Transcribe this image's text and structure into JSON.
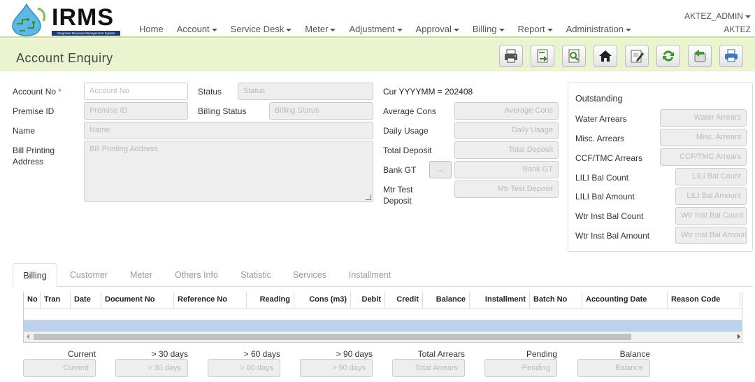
{
  "app": {
    "logo_text": "IRMS",
    "logo_subtitle": "Integrated Revenue Management System"
  },
  "nav": {
    "items": [
      {
        "label": "Home",
        "dropdown": false
      },
      {
        "label": "Account",
        "dropdown": true
      },
      {
        "label": "Service Desk",
        "dropdown": true
      },
      {
        "label": "Meter",
        "dropdown": true
      },
      {
        "label": "Adjustment",
        "dropdown": true
      },
      {
        "label": "Approval",
        "dropdown": true
      },
      {
        "label": "Billing",
        "dropdown": true
      },
      {
        "label": "Report",
        "dropdown": true
      },
      {
        "label": "Administration",
        "dropdown": true
      }
    ]
  },
  "user": {
    "menu_label": "AKTEZ_ADMIN",
    "name": "AKTEZ"
  },
  "page": {
    "title": "Account Enquiry"
  },
  "toolbar": {
    "buttons": [
      {
        "icon": "printer-icon"
      },
      {
        "icon": "export-icon"
      },
      {
        "icon": "search-document-icon"
      },
      {
        "icon": "home-icon"
      },
      {
        "icon": "edit-icon"
      },
      {
        "icon": "refresh-icon"
      },
      {
        "icon": "back-icon"
      },
      {
        "icon": "print-icon"
      }
    ]
  },
  "form": {
    "account_no": {
      "label": "Account No",
      "required_mark": "*",
      "placeholder": "Account No"
    },
    "status": {
      "label": "Status",
      "placeholder": "Status"
    },
    "premise_id": {
      "label": "Premise ID",
      "placeholder": "Premise ID"
    },
    "billing_status": {
      "label": "Billing Status",
      "placeholder": "Billing Status"
    },
    "name": {
      "label": "Name",
      "placeholder": "Name"
    },
    "bill_printing_address": {
      "label_line1": "Bill Printing",
      "label_line2": "Address",
      "placeholder": "Bill Printing Address"
    },
    "cur_period": "Cur YYYYMM = 202408",
    "average_cons": {
      "label": "Average Cons",
      "placeholder": "Average Cons"
    },
    "daily_usage": {
      "label": "Daily Usage",
      "placeholder": "Daily Usage"
    },
    "total_deposit": {
      "label": "Total Deposit",
      "placeholder": "Total Deposit"
    },
    "bank_gt": {
      "label": "Bank GT",
      "button_label": "...",
      "placeholder": "Bank GT"
    },
    "mtr_test_deposit": {
      "label_line1": "Mtr Test",
      "label_line2": "Deposit",
      "placeholder": "Mtr Test Deposit"
    }
  },
  "outstanding": {
    "title": "Outstanding",
    "fields": [
      {
        "label": "Water Arrears",
        "placeholder": "Water Arrears"
      },
      {
        "label": "Misc. Arrears",
        "placeholder": "Misc. Arrears"
      },
      {
        "label": "CCF/TMC Arrears",
        "placeholder": "CCF/TMC Arrears"
      },
      {
        "label": "LILI Bal Count",
        "placeholder": "LILI Bal Count"
      },
      {
        "label": "LILI Bal Amount",
        "placeholder": "LILI Bal Amount"
      },
      {
        "label": "Wtr Inst Bal Count",
        "placeholder": "Wtr Inst Bal Count"
      },
      {
        "label": "Wtr Inst Bal Amount",
        "placeholder": "Wtr Inst Bal Amount"
      }
    ]
  },
  "tabs": [
    {
      "label": "Billing",
      "active": true
    },
    {
      "label": "Customer",
      "active": false
    },
    {
      "label": "Meter",
      "active": false
    },
    {
      "label": "Others Info",
      "active": false
    },
    {
      "label": "Statistic",
      "active": false
    },
    {
      "label": "Services",
      "active": false
    },
    {
      "label": "Installment",
      "active": false
    }
  ],
  "table": {
    "columns": [
      "No",
      "Tran",
      "Date",
      "Document No",
      "Reference No",
      "Reading",
      "Cons (m3)",
      "Debit",
      "Credit",
      "Balance",
      "Installment",
      "Batch No",
      "Accounting Date",
      "Reason Code"
    ],
    "selected_row_color": "#bcd2ea"
  },
  "summary": [
    {
      "label": "Current",
      "placeholder": "Current"
    },
    {
      "label": "> 30 days",
      "placeholder": "> 30 days"
    },
    {
      "label": "> 60 days",
      "placeholder": "> 60 days"
    },
    {
      "label": "> 90 days",
      "placeholder": "> 90 days"
    },
    {
      "label": "Total Arrears",
      "placeholder": "Total Arrears"
    },
    {
      "label": "Pending",
      "placeholder": "Pending"
    },
    {
      "label": "Balance",
      "placeholder": "Balance"
    }
  ],
  "colors": {
    "title_bar": "#eaf4cf",
    "accent_border": "#c9e08a",
    "required": "#d9534f"
  }
}
